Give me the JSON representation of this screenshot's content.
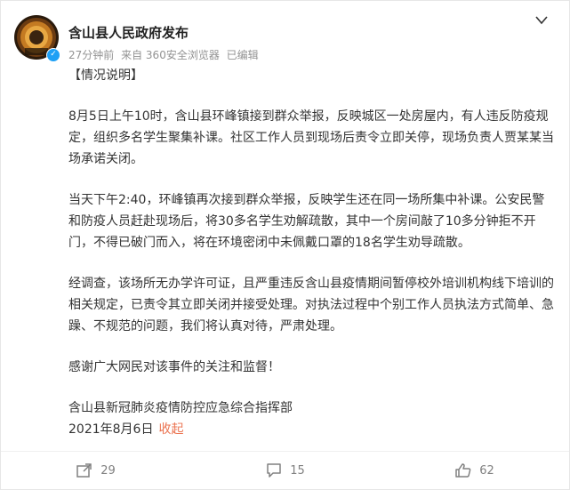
{
  "post": {
    "username": "含山县人民政府发布",
    "verified": true,
    "time": "27分钟前",
    "source": "来自 360安全浏览器",
    "edited": "已编辑",
    "title": "【情况说明】",
    "paragraphs": [
      "8月5日上午10时，含山县环峰镇接到群众举报，反映城区一处房屋内，有人违反防疫规定，组织多名学生聚集补课。社区工作人员到现场后责令立即关停，现场负责人贾某某当场承诺关闭。",
      "当天下午2:40，环峰镇再次接到群众举报，反映学生还在同一场所集中补课。公安民警和防疫人员赶赴现场后，将30多名学生劝解疏散，其中一个房间敲了10多分钟拒不开门，不得已破门而入，将在环境密闭中未佩戴口罩的18名学生劝导疏散。",
      "经调查，该场所无办学许可证，且严重违反含山县疫情期间暂停校外培训机构线下培训的相关规定，已责令其立即关闭并接受处理。对执法过程中个别工作人员执法方式简单、急躁、不规范的问题，我们将认真对待，严肃处理。",
      "感谢广大网民对该事件的关注和监督！"
    ],
    "signature": "含山县新冠肺炎疫情防控应急综合指挥部",
    "date": "2021年8月6日",
    "collapse_label": "收起"
  },
  "actions": {
    "repost_count": "29",
    "comment_count": "15",
    "like_count": "62"
  },
  "icons": {
    "more": "chevron-down-icon",
    "verified": "verified-badge-icon",
    "repost": "share-icon",
    "comment": "comment-icon",
    "like": "thumbs-up-icon"
  },
  "colors": {
    "verified_blue": "#1ea0f5",
    "collapse_orange": "#eb7350",
    "meta_gray": "#939393"
  }
}
